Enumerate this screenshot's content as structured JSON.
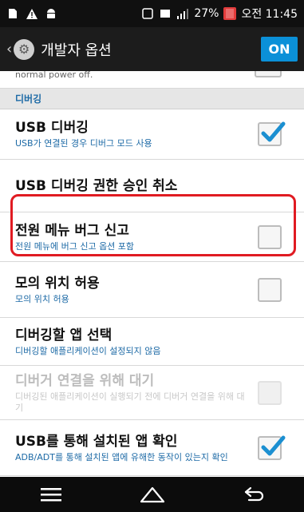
{
  "status_bar": {
    "battery_percent": "27%",
    "time": "오전 11:45",
    "icons": [
      "sim-icon",
      "warning-icon",
      "android-icon",
      "nfc-icon",
      "screenshot-icon",
      "signal-icon",
      "battery-icon"
    ]
  },
  "header": {
    "back_icon": "chevron-left-icon",
    "app_icon": "settings-gear-icon",
    "title": "개발자 옵션",
    "toggle_label": "ON",
    "toggle_color": "#0b90d8"
  },
  "partial_row": {
    "subtitle": "normal power off."
  },
  "section": {
    "title": "디버깅"
  },
  "settings": [
    {
      "title": "USB 디버깅",
      "subtitle": "USB가 연결된 경우 디버그 모드 사용",
      "checked": true,
      "enabled": true,
      "has_checkbox": true
    },
    {
      "title": "USB 디버깅 권한 승인 취소",
      "subtitle": "",
      "checked": false,
      "enabled": true,
      "has_checkbox": false
    },
    {
      "title": "전원 메뉴 버그 신고",
      "subtitle": "전원 메뉴에 버그 신고 옵션 포함",
      "checked": false,
      "enabled": true,
      "has_checkbox": true
    },
    {
      "title": "모의 위치 허용",
      "subtitle": "모의 위치 허용",
      "checked": false,
      "enabled": true,
      "has_checkbox": true,
      "highlighted": true
    },
    {
      "title": "디버깅할 앱 선택",
      "subtitle": "디버깅할 애플리케이션이 설정되지 않음",
      "checked": false,
      "enabled": true,
      "has_checkbox": false
    },
    {
      "title": "디버거 연결을 위해 대기",
      "subtitle": "디버깅된 애플리케이션이 실행되기 전에 디버거 연결을 위해 대기",
      "checked": false,
      "enabled": false,
      "has_checkbox": true
    },
    {
      "title": "USB를 통해 설치된 앱 확인",
      "subtitle": "ADB/ADT를 통해 설치된 앱에 유해한 동작이 있는지 확인",
      "checked": true,
      "enabled": true,
      "has_checkbox": true
    }
  ],
  "nav_bar": {
    "buttons": [
      "menu-icon",
      "home-icon",
      "back-icon"
    ]
  },
  "colors": {
    "accent": "#0b90d8",
    "highlight": "#e01b22",
    "checkmark": "#1b8fd1"
  }
}
